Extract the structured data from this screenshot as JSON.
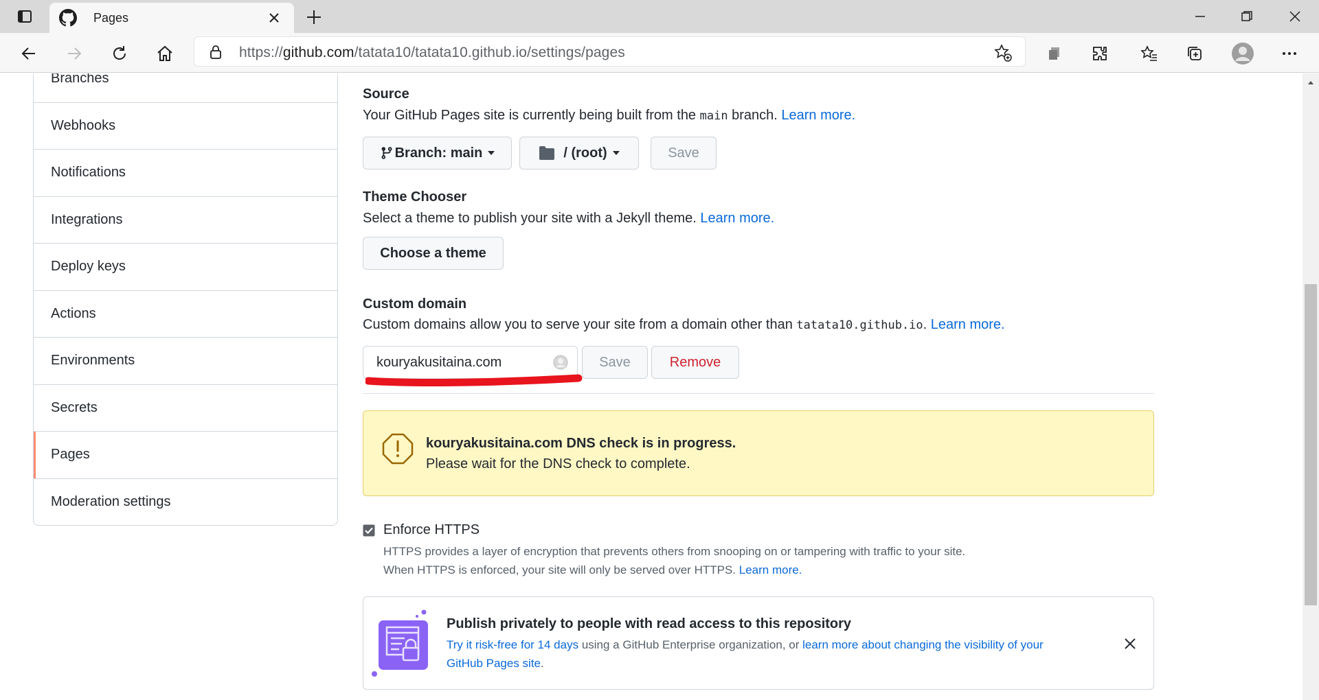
{
  "browser": {
    "tab_title": "Pages",
    "url_prefix": "https://",
    "url_host": "github.com",
    "url_path": "/tatata10/tatata10.github.io/settings/pages"
  },
  "sidebar": {
    "items": [
      {
        "label": "Branches"
      },
      {
        "label": "Webhooks"
      },
      {
        "label": "Notifications"
      },
      {
        "label": "Integrations"
      },
      {
        "label": "Deploy keys"
      },
      {
        "label": "Actions"
      },
      {
        "label": "Environments"
      },
      {
        "label": "Secrets"
      },
      {
        "label": "Pages",
        "active": true
      },
      {
        "label": "Moderation settings"
      }
    ]
  },
  "source": {
    "heading": "Source",
    "desc_before": "Your GitHub Pages site is currently being built from the ",
    "branch_code": "main",
    "desc_after": " branch. ",
    "learn_more": "Learn more.",
    "branch_button": "Branch: main",
    "folder_button": "/ (root)",
    "save": "Save"
  },
  "theme": {
    "heading": "Theme Chooser",
    "desc": "Select a theme to publish your site with a Jekyll theme. ",
    "learn_more": "Learn more.",
    "button": "Choose a theme"
  },
  "custom_domain": {
    "heading": "Custom domain",
    "desc": "Custom domains allow you to serve your site from a domain other than ",
    "domain_code": "tatata10.github.io",
    "desc_after": ". ",
    "learn_more": "Learn more.",
    "value": "kouryakusitaina.com",
    "save": "Save",
    "remove": "Remove"
  },
  "dns_flash": {
    "title": "kouryakusitaina.com DNS check is in progress.",
    "body": "Please wait for the DNS check to complete."
  },
  "https": {
    "label": "Enforce HTTPS",
    "checked": true,
    "line1": "HTTPS provides a layer of encryption that prevents others from snooping on or tampering with traffic to your site.",
    "line2": "When HTTPS is enforced, your site will only be served over HTTPS. ",
    "learn_more": "Learn more."
  },
  "promo": {
    "title": "Publish privately to people with read access to this repository",
    "link1": "Try it risk-free for 14 days",
    "text_mid": " using a GitHub Enterprise organization, or ",
    "link2_line1": "learn more about changing the visibility of your",
    "link2_line2": "GitHub Pages site",
    "text_end": "."
  },
  "colors": {
    "link": "#0969da",
    "danger": "#cf222e",
    "warn_bg": "#fff8c5",
    "annotation": "#e8141e",
    "active_marker": "#fd8c73",
    "promo_icon": "#8a63f5"
  }
}
